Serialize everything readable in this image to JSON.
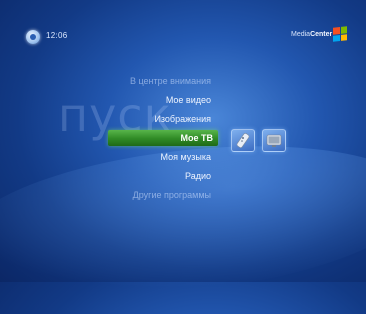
{
  "header": {
    "clock": "12:06",
    "brand_prefix": "Media",
    "brand_suffix": "Center"
  },
  "background_word": "пуск",
  "menu": {
    "items": [
      {
        "label": "В центре внимания",
        "dim": true
      },
      {
        "label": "Мое видео",
        "dim": false
      },
      {
        "label": "Изображения",
        "dim": false
      },
      {
        "label": "Мое ТВ",
        "dim": false,
        "selected": true
      },
      {
        "label": "Моя музыка",
        "dim": false
      },
      {
        "label": "Радио",
        "dim": false
      },
      {
        "label": "Другие программы",
        "dim": true
      }
    ]
  },
  "tiles": [
    {
      "icon": "remote-control-icon"
    },
    {
      "icon": "tv-guide-icon"
    }
  ],
  "colors": {
    "background": "#2257b0",
    "selection": "#3b9a2e",
    "text": "#eef4ff"
  }
}
